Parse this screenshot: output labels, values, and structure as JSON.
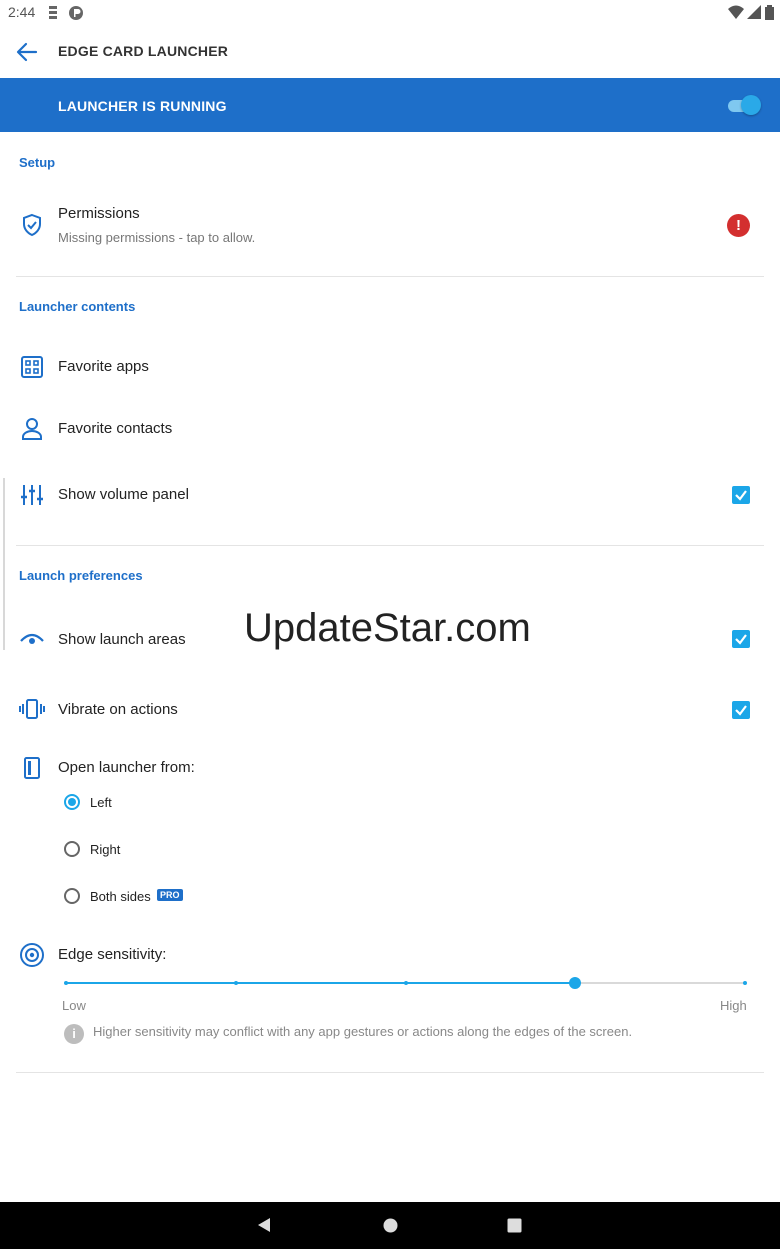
{
  "status_bar": {
    "time": "2:44"
  },
  "toolbar": {
    "title": "EDGE CARD LAUNCHER"
  },
  "banner": {
    "label": "LAUNCHER IS RUNNING",
    "toggle_on": true
  },
  "setup": {
    "header": "Setup",
    "permissions": {
      "title": "Permissions",
      "subtitle": "Missing permissions - tap to allow.",
      "alert": "!"
    }
  },
  "launcher_contents": {
    "header": "Launcher contents",
    "favorite_apps": "Favorite apps",
    "favorite_contacts": "Favorite contacts",
    "show_volume_panel": {
      "label": "Show volume panel",
      "checked": true
    }
  },
  "launch_preferences": {
    "header": "Launch preferences",
    "show_launch_areas": {
      "label": "Show launch areas",
      "checked": true
    },
    "vibrate_on_actions": {
      "label": "Vibrate on actions",
      "checked": true
    },
    "open_from": {
      "label": "Open launcher from:",
      "options": [
        "Left",
        "Right",
        "Both sides"
      ],
      "selected": "Left",
      "pro_badge": "PRO"
    },
    "edge_sensitivity": {
      "label": "Edge sensitivity:",
      "low_label": "Low",
      "high_label": "High",
      "value_fraction": 0.75,
      "steps": 5,
      "info": "Higher sensitivity may conflict with any app gestures or actions along the edges of the screen.",
      "info_icon": "i"
    }
  },
  "watermark": "UpdateStar.com",
  "colors": {
    "accent": "#1e6fc9",
    "accent_light": "#1ba6e8",
    "alert": "#d32f2f"
  }
}
